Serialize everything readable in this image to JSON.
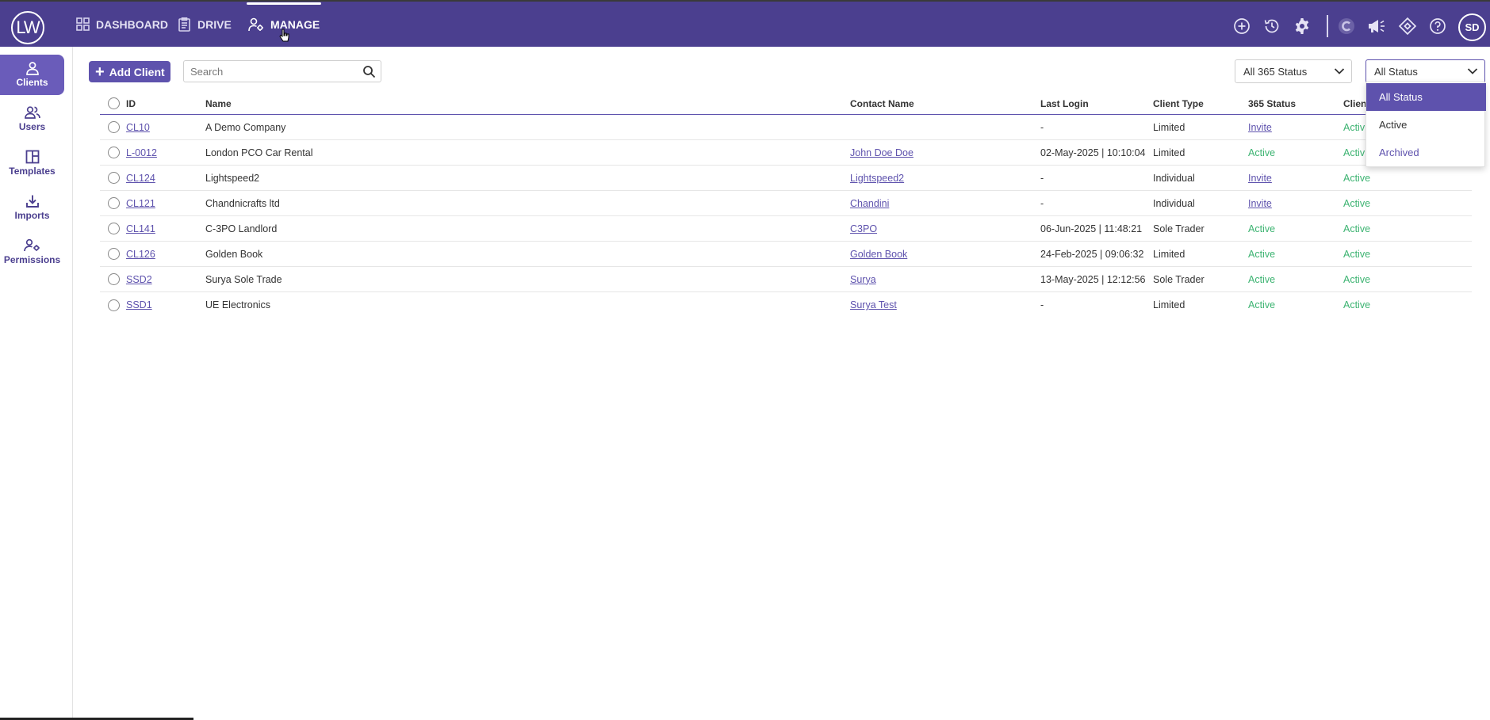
{
  "app": {
    "logo_text": "LW",
    "user_initials": "SD"
  },
  "nav": [
    {
      "label": "DASHBOARD",
      "icon": "grid-icon"
    },
    {
      "label": "DRIVE",
      "icon": "clipboard-icon"
    },
    {
      "label": "MANAGE",
      "icon": "user-gear-icon",
      "active": true
    }
  ],
  "top_icons": [
    "add-circle-icon",
    "history-icon",
    "settings-icon",
    "c-logo-icon",
    "megaphone-icon",
    "diamond-icon",
    "help-icon"
  ],
  "sidebar": {
    "items": [
      {
        "label": "Clients",
        "icon": "user-icon",
        "active": true
      },
      {
        "label": "Users",
        "icon": "users-icon"
      },
      {
        "label": "Templates",
        "icon": "template-icon"
      },
      {
        "label": "Imports",
        "icon": "import-icon"
      },
      {
        "label": "Permissions",
        "icon": "user-key-icon"
      }
    ]
  },
  "toolbar": {
    "add_label": "Add Client",
    "search_placeholder": "Search",
    "filter_365": "All 365 Status",
    "filter_status": "All Status"
  },
  "table": {
    "headers": {
      "id": "ID",
      "name": "Name",
      "contact": "Contact Name",
      "login": "Last Login",
      "type": "Client Type",
      "s365": "365 Status",
      "client_status": "Clien"
    },
    "rows": [
      {
        "id": "CL10",
        "name": "A Demo Company",
        "contact": "",
        "login": "-",
        "type": "Limited",
        "s365": "Invite",
        "status": "Activ"
      },
      {
        "id": "L-0012",
        "name": "London PCO Car Rental",
        "contact": "John Doe Doe",
        "login": "02-May-2025 | 10:10:04",
        "type": "Limited",
        "s365": "Active",
        "status": "Activ"
      },
      {
        "id": "CL124",
        "name": "Lightspeed2",
        "contact": "Lightspeed2",
        "login": "-",
        "type": "Individual",
        "s365": "Invite",
        "status": "Active"
      },
      {
        "id": "CL121",
        "name": "Chandnicrafts ltd",
        "contact": "Chandini",
        "login": "-",
        "type": "Individual",
        "s365": "Invite",
        "status": "Active"
      },
      {
        "id": "CL141",
        "name": "C-3PO Landlord",
        "contact": "C3PO",
        "login": "06-Jun-2025 | 11:48:21",
        "type": "Sole Trader",
        "s365": "Active",
        "status": "Active"
      },
      {
        "id": "CL126",
        "name": "Golden Book",
        "contact": "Golden Book",
        "login": "24-Feb-2025 | 09:06:32",
        "type": "Limited",
        "s365": "Active",
        "status": "Active"
      },
      {
        "id": "SSD2",
        "name": "Surya Sole Trade",
        "contact": "Surya",
        "login": "13-May-2025 | 12:12:56",
        "type": "Sole Trader",
        "s365": "Active",
        "status": "Active"
      },
      {
        "id": "SSD1",
        "name": "UE Electronics",
        "contact": "Surya Test",
        "login": "-",
        "type": "Limited",
        "s365": "Active",
        "status": "Active"
      }
    ]
  },
  "status_dropdown": {
    "options": [
      "All Status",
      "Active",
      "Archived"
    ],
    "selected": "All Status"
  },
  "colors": {
    "brand": "#4b3f8f",
    "accent": "#5e52ad",
    "active_green": "#3cb371"
  }
}
